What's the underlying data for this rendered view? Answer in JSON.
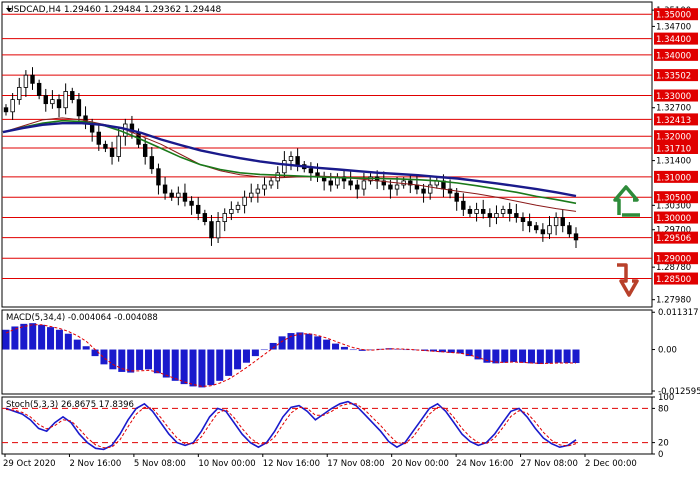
{
  "header": {
    "symbol_line": "USDCAD,H4  1.29460 1.29484 1.29362 1.29448"
  },
  "colors": {
    "background": "#ffffff",
    "frame": "#000000",
    "level_line": "#e00000",
    "level_label_bg": "#e00000",
    "level_label_text": "#ffffff",
    "candle": "#000000",
    "ma_fast": "#8b1a1a",
    "ma_mid": "#1a7a1a",
    "ma_slow": "#1a1a8b",
    "macd_bar": "#1a1acc",
    "macd_signal": "#e00000",
    "stoch_main": "#1a1acc",
    "stoch_signal": "#e00000",
    "arrow_up": "#2e8b3a",
    "arrow_down": "#b8402a"
  },
  "chart_data": [
    {
      "type": "candlestick",
      "title": "USDCAD,H4",
      "ohlc_readout": {
        "open": 1.2946,
        "high": 1.29484,
        "low": 1.29362,
        "close": 1.29448
      },
      "ylim": [
        1.278,
        1.353
      ],
      "y_tick_labels": [
        "1.35100",
        "1.35000",
        "1.34700",
        "1.34400",
        "1.34000",
        "1.33502",
        "1.33000",
        "1.32700",
        "1.32413",
        "1.32000",
        "1.31710",
        "1.31400",
        "1.31000",
        "1.30500",
        "1.30300",
        "1.30000",
        "1.29700",
        "1.29506",
        "1.29000",
        "1.28780",
        "1.28500",
        "1.27980"
      ],
      "y_tick_values": [
        1.351,
        1.35,
        1.347,
        1.344,
        1.34,
        1.33502,
        1.33,
        1.327,
        1.32413,
        1.32,
        1.3171,
        1.314,
        1.31,
        1.305,
        1.303,
        1.3,
        1.297,
        1.29506,
        1.29,
        1.2878,
        1.285,
        1.2798
      ],
      "highlighted_levels": [
        1.35,
        1.344,
        1.34,
        1.33502,
        1.33,
        1.32413,
        1.32,
        1.3171,
        1.31,
        1.305,
        1.3,
        1.29506,
        1.29,
        1.285
      ],
      "highlighted_labels": [
        "1.35000",
        "1.34400",
        "1.34000",
        "1.33502",
        "1.33000",
        "1.32413",
        "1.32000",
        "1.31710",
        "1.31000",
        "1.30500",
        "1.30000",
        "1.29506",
        "1.29000",
        "1.28500"
      ],
      "x_tick_labels": [
        "29 Oct 2020",
        "2 Nov 16:00",
        "5 Nov 08:00",
        "10 Nov 00:00",
        "12 Nov 16:00",
        "17 Nov 08:00",
        "20 Nov 00:00",
        "24 Nov 16:00",
        "27 Nov 08:00",
        "2 Dec 00:00"
      ],
      "series_close": [
        1.326,
        1.329,
        1.332,
        1.335,
        1.333,
        1.33,
        1.328,
        1.329,
        1.327,
        1.331,
        1.329,
        1.325,
        1.323,
        1.321,
        1.318,
        1.317,
        1.315,
        1.32,
        1.323,
        1.321,
        1.318,
        1.315,
        1.312,
        1.308,
        1.306,
        1.305,
        1.306,
        1.304,
        1.303,
        1.301,
        1.299,
        1.295,
        1.299,
        1.301,
        1.302,
        1.303,
        1.305,
        1.306,
        1.307,
        1.308,
        1.309,
        1.311,
        1.314,
        1.315,
        1.313,
        1.312,
        1.311,
        1.31,
        1.309,
        1.308,
        1.31,
        1.309,
        1.308,
        1.307,
        1.309,
        1.31,
        1.309,
        1.308,
        1.307,
        1.308,
        1.309,
        1.308,
        1.307,
        1.306,
        1.308,
        1.309,
        1.307,
        1.306,
        1.304,
        1.302,
        1.301,
        1.302,
        1.301,
        1.3,
        1.301,
        1.302,
        1.301,
        1.3,
        1.299,
        1.298,
        1.297,
        1.296,
        1.298,
        1.3,
        1.298,
        1.296,
        1.2945
      ],
      "series_high_offset": 0.0018,
      "series_low_offset": 0.0018,
      "moving_averages": [
        {
          "points": [
            1.321,
            1.3225,
            1.324,
            1.3245,
            1.324,
            1.323,
            1.322,
            1.32,
            1.318,
            1.3155,
            1.313,
            1.3115,
            1.3105,
            1.31,
            1.3098,
            1.31,
            1.3102,
            1.31,
            1.3095,
            1.309,
            1.3085,
            1.308,
            1.3072,
            1.3065,
            1.3058,
            1.305,
            1.304,
            1.303,
            1.3022,
            1.3015
          ]
        },
        {
          "points": [
            1.321,
            1.3222,
            1.3232,
            1.3238,
            1.3236,
            1.3228,
            1.3212,
            1.3192,
            1.317,
            1.3148,
            1.313,
            1.3118,
            1.311,
            1.3106,
            1.3104,
            1.3102,
            1.31,
            1.3098,
            1.3097,
            1.3096,
            1.3095,
            1.3093,
            1.309,
            1.3085,
            1.3078,
            1.307,
            1.3062,
            1.3052,
            1.3044,
            1.3035
          ]
        },
        {
          "points": [
            1.321,
            1.322,
            1.3228,
            1.3232,
            1.3232,
            1.3228,
            1.322,
            1.3208,
            1.3192,
            1.3178,
            1.3165,
            1.3155,
            1.3146,
            1.3138,
            1.3132,
            1.3127,
            1.3122,
            1.3118,
            1.3114,
            1.311,
            1.3107,
            1.3104,
            1.31,
            1.3096,
            1.309,
            1.3084,
            1.3077,
            1.307,
            1.3062,
            1.3053
          ]
        }
      ]
    },
    {
      "type": "bar",
      "title": "MACD(5,34,4) -0.004064 -0.004088",
      "ylim": [
        -0.0135,
        0.012
      ],
      "y_tick_labels": [
        "0.011317",
        "0.00",
        "-0.012595"
      ],
      "y_tick_values": [
        0.011317,
        0.0,
        -0.012595
      ],
      "values": [
        0.006,
        0.007,
        0.0078,
        0.008,
        0.0075,
        0.0068,
        0.006,
        0.0048,
        0.003,
        0.001,
        -0.002,
        -0.0045,
        -0.006,
        -0.0068,
        -0.007,
        -0.0062,
        -0.006,
        -0.0072,
        -0.0085,
        -0.0095,
        -0.0105,
        -0.0112,
        -0.0115,
        -0.0108,
        -0.0095,
        -0.008,
        -0.006,
        -0.004,
        -0.002,
        0.0,
        0.002,
        0.004,
        0.005,
        0.0052,
        0.0048,
        0.004,
        0.003,
        0.0018,
        0.0008,
        0.0,
        -0.0004,
        -0.0002,
        0.0002,
        0.0004,
        0.0002,
        0.0,
        -0.0002,
        -0.0004,
        -0.0006,
        -0.0008,
        -0.001,
        -0.0012,
        -0.002,
        -0.003,
        -0.004,
        -0.0042,
        -0.004,
        -0.0038,
        -0.004,
        -0.0042,
        -0.0044,
        -0.0042,
        -0.004,
        -0.0041,
        -0.0041
      ],
      "signal": [
        0.005,
        0.0062,
        0.007,
        0.0075,
        0.0075,
        0.007,
        0.0064,
        0.0055,
        0.0042,
        0.0025,
        0.0,
        -0.0025,
        -0.0045,
        -0.0058,
        -0.0065,
        -0.0065,
        -0.0063,
        -0.0068,
        -0.0078,
        -0.0088,
        -0.0098,
        -0.0106,
        -0.0112,
        -0.011,
        -0.0102,
        -0.009,
        -0.0073,
        -0.0055,
        -0.0035,
        -0.0015,
        0.0005,
        0.0025,
        0.004,
        0.0047,
        0.0048,
        0.0043,
        0.0035,
        0.0025,
        0.0015,
        0.0006,
        0.0,
        -0.0002,
        0.0,
        0.0002,
        0.0002,
        0.0001,
        -0.0001,
        -0.0003,
        -0.0005,
        -0.0007,
        -0.0009,
        -0.0011,
        -0.0016,
        -0.0024,
        -0.0033,
        -0.0038,
        -0.0039,
        -0.0038,
        -0.0039,
        -0.0041,
        -0.0042,
        -0.0042,
        -0.0041,
        -0.0041,
        -0.0041
      ]
    },
    {
      "type": "line",
      "title": "Stoch(5,3,3) 26.8675 17.8396",
      "ylim": [
        0,
        100
      ],
      "y_tick_labels": [
        "100",
        "80",
        "20",
        "0"
      ],
      "y_tick_values": [
        100,
        80,
        20,
        0
      ],
      "reference_levels": [
        80,
        20
      ],
      "series": [
        {
          "values": [
            80,
            75,
            70,
            60,
            45,
            40,
            55,
            65,
            55,
            35,
            20,
            10,
            8,
            15,
            35,
            60,
            80,
            88,
            75,
            55,
            35,
            20,
            15,
            20,
            40,
            65,
            80,
            75,
            55,
            35,
            20,
            12,
            20,
            40,
            65,
            82,
            85,
            75,
            60,
            70,
            80,
            88,
            92,
            85,
            70,
            55,
            40,
            22,
            12,
            20,
            40,
            60,
            80,
            88,
            75,
            55,
            35,
            22,
            15,
            20,
            35,
            55,
            75,
            80,
            65,
            45,
            28,
            18,
            12,
            15,
            25
          ]
        },
        {
          "values": [
            78,
            77,
            73,
            65,
            52,
            44,
            50,
            60,
            58,
            44,
            28,
            16,
            11,
            12,
            25,
            48,
            70,
            82,
            80,
            64,
            45,
            28,
            18,
            18,
            30,
            52,
            72,
            78,
            64,
            45,
            28,
            18,
            18,
            30,
            52,
            72,
            82,
            80,
            68,
            68,
            75,
            84,
            88,
            88,
            78,
            64,
            50,
            34,
            20,
            18,
            30,
            50,
            70,
            82,
            80,
            64,
            45,
            30,
            20,
            18,
            28,
            46,
            66,
            76,
            72,
            56,
            38,
            24,
            16,
            14,
            18
          ]
        }
      ]
    }
  ],
  "annotations": {
    "arrow_up": "green-up-arrow",
    "arrow_down": "red-down-arrow"
  }
}
